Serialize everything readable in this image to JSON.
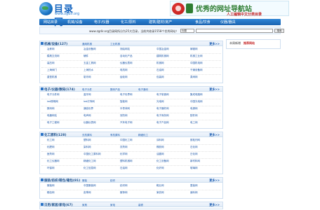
{
  "header": {
    "logo_title": "目录网",
    "logo_url": "www.zgdir.org",
    "banner_title": "优秀的网址导航站",
    "banner_sub": "人工编辑中文分类目录"
  },
  "nav": [
    "网站目录",
    "机械/设备",
    "电子/仪器",
    "化工/原料",
    "建筑/建材/房产",
    "食品/饮食",
    "仪器/器具"
  ],
  "infobar": {
    "text": "www.zgdir.org目录网所分为25大目录，当前共收录1558个优秀网站！",
    "select_value": "标题",
    "button_label": "搜索"
  },
  "sidebar": {
    "tabs": [
      "本周新增",
      "推荐网站"
    ]
  },
  "sections": [
    {
      "title": "机械/设备(127)",
      "subs": [
        "通用机械",
        "工业机械"
      ],
      "more": "更多>>",
      "rows": [
        [
          "冶炼网",
          "冶金设备网",
          "测绘网站",
          "中国冶金网",
          "铸锻网"
        ],
        [
          "模具交流网",
          "辅件",
          "自动化产品",
          "建筑机械网",
          "机械工业网"
        ],
        [
          "高压网",
          "五金工具网",
          "仪器仪表网",
          "机械网",
          "中国机电网"
        ],
        [
          "上海阀门",
          "上海热水",
          "电机网",
          "石油网",
          "干燥设备网"
        ],
        [
          "重型机械",
          "制冷网",
          "齿轮网",
          "包装网",
          "泵阀网"
        ]
      ]
    },
    {
      "title": "电子/仪器/数码(174)",
      "subs": [
        "电子元件",
        "数码产品",
        "电子通讯"
      ],
      "more": "更多>>",
      "rows": [
        [
          "电子元件网",
          "蓝牙网",
          "电子世界网",
          "电子制造网",
          "集成电路网"
        ],
        [
          "led照明网",
          "led灯饰网",
          "智能网",
          "光电网",
          "中国光电网"
        ],
        [
          "数码网",
          "通信世界",
          "半导体网",
          "电子器件网",
          "电源网"
        ],
        [
          "电器网站",
          "电声网",
          "安防网",
          "电子商务网",
          "配件网"
        ],
        [
          "电子工程网",
          "仪器仪表网",
          "汽车电子网",
          "电子产品网",
          "电工网"
        ]
      ]
    },
    {
      "title": "化工原料(128)",
      "subs": [
        "无机原料",
        "有机原料",
        "精细化工"
      ],
      "more": "更多>>",
      "rows": [
        [
          "化工网",
          "塑料网",
          "中国化工网",
          "涂料网",
          "胶粘剂网"
        ],
        [
          "化肥网",
          "染料网",
          "农药网",
          "橡胶网",
          "石化网"
        ],
        [
          "医药网",
          "中国化工原料网",
          "化学网",
          "油墨网",
          "日化网"
        ],
        [
          "化工仪器网",
          "精细化工网",
          "塑料机械网",
          "化工设备网",
          "新材料网"
        ],
        [
          "环保网",
          "化工信息网",
          "石油网",
          "化纤网",
          "玻璃网"
        ]
      ]
    },
    {
      "title": "服装/纺织/鞋包/箱包(81)",
      "subs": [
        "服装",
        "纺织"
      ],
      "more": "更多>>",
      "rows": [
        [
          "服装网",
          "中国服装网",
          "纺织网",
          "鞋业网",
          "童装网"
        ],
        [
          "箱包网",
          "皮革网",
          "服饰网",
          "家纺网",
          "面料网"
        ]
      ]
    },
    {
      "title": "日用/家居/家电(67)",
      "subs": [
        "家具",
        "家电",
        "装修"
      ],
      "more": "更多>>",
      "rows": []
    }
  ]
}
